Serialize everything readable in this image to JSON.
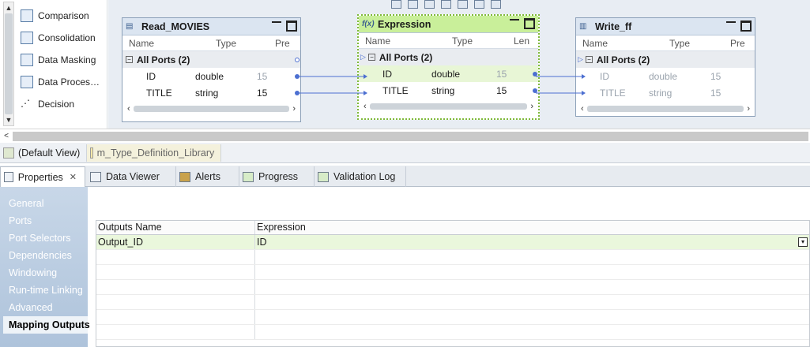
{
  "palette": {
    "items": [
      {
        "label": "Comparison",
        "icon": "comparison-icon"
      },
      {
        "label": "Consolidation",
        "icon": "consolidation-icon"
      },
      {
        "label": "Data Masking",
        "icon": "data-masking-icon"
      },
      {
        "label": "Data Proces…",
        "icon": "data-processor-icon"
      },
      {
        "label": "Decision",
        "icon": "decision-icon"
      }
    ]
  },
  "transformations": {
    "read": {
      "title": "Read_MOVIES",
      "columns": [
        "Name",
        "Type",
        "Pre"
      ],
      "group": "All Ports (2)",
      "ports": [
        {
          "name": "ID",
          "type": "double",
          "prec": "15"
        },
        {
          "name": "TITLE",
          "type": "string",
          "prec": "15"
        }
      ]
    },
    "expression": {
      "title": "Expression",
      "columns": [
        "Name",
        "Type",
        "Len"
      ],
      "group": "All Ports (2)",
      "ports": [
        {
          "name": "ID",
          "type": "double",
          "prec": "15"
        },
        {
          "name": "TITLE",
          "type": "string",
          "prec": "15"
        }
      ]
    },
    "write": {
      "title": "Write_ff",
      "columns": [
        "Name",
        "Type",
        "Pre"
      ],
      "group": "All Ports (2)",
      "ports": [
        {
          "name": "ID",
          "type": "double",
          "prec": "15"
        },
        {
          "name": "TITLE",
          "type": "string",
          "prec": "15"
        }
      ]
    }
  },
  "view_tabs": {
    "default": "(Default View)",
    "library": "m_Type_Definition_Library"
  },
  "panel_tabs": {
    "properties": "Properties",
    "data_viewer": "Data Viewer",
    "alerts": "Alerts",
    "progress": "Progress",
    "validation_log": "Validation Log"
  },
  "side_nav": {
    "general": "General",
    "ports": "Ports",
    "port_selectors": "Port Selectors",
    "dependencies": "Dependencies",
    "windowing": "Windowing",
    "runtime_linking": "Run-time Linking",
    "advanced": "Advanced",
    "mapping_outputs": "Mapping Outputs"
  },
  "outputs_table": {
    "col_name": "Outputs Name",
    "col_expression": "Expression",
    "rows": [
      {
        "name": "Output_ID",
        "expression": "ID"
      }
    ]
  },
  "colors": {
    "expression_header": "#c9ef9a",
    "link": "#4c6fd1",
    "selected_row": "#eaf7dc"
  }
}
